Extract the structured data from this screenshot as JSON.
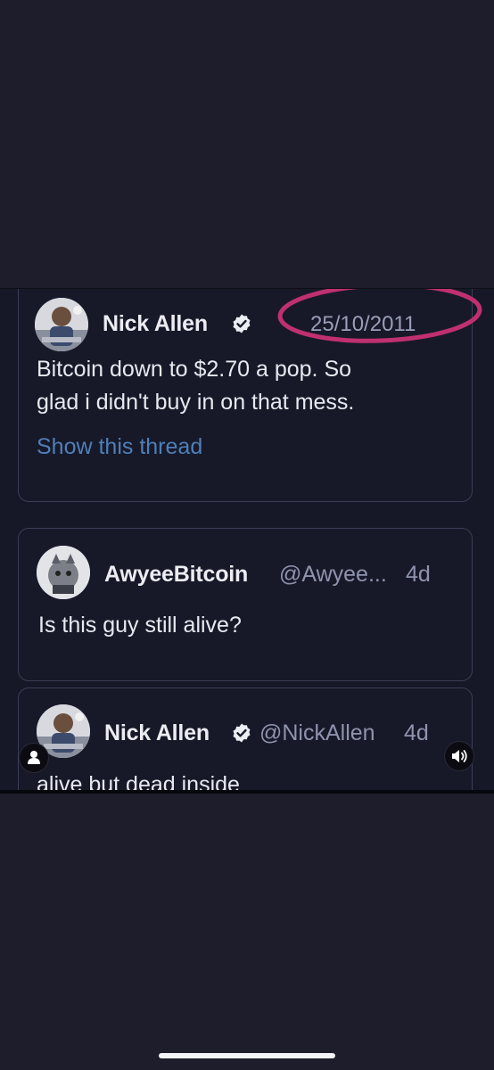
{
  "tweets": [
    {
      "name": "Nick Allen",
      "verified": true,
      "date": "25/10/2011",
      "text_lines": [
        "Bitcoin down to $2.70 a pop. So",
        "glad i didn't buy in on that mess."
      ],
      "link": "Show this thread"
    },
    {
      "name": "AwyeeBitcoin",
      "verified": false,
      "handle": "@Awyee...",
      "time": "4d",
      "text_lines": [
        "Is this guy still alive?"
      ]
    },
    {
      "name": "Nick Allen",
      "verified": true,
      "handle": "@NickAllen",
      "time": "4d",
      "text_lines": [
        "alive but dead inside"
      ]
    }
  ],
  "highlight": {
    "color": "#c03070",
    "shape": "ellipse"
  },
  "controls": {
    "left_icon": "person-icon",
    "right_icon": "speaker-icon"
  },
  "colors": {
    "background": "#1d1d2c",
    "link": "#4f7fb8"
  }
}
